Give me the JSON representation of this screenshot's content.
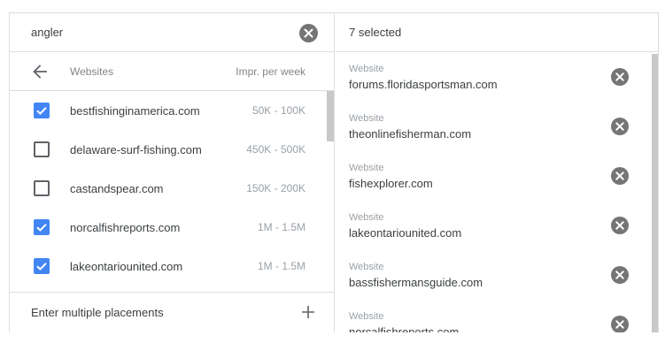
{
  "search": {
    "value": "angler",
    "clear_icon": "clear-circle-icon"
  },
  "table_header": {
    "back_icon": "arrow-back-icon",
    "col_websites": "Websites",
    "col_impressions": "Impr. per week"
  },
  "results": [
    {
      "name": "bestfishinginamerica.com",
      "impressions": "50K - 100K",
      "checked": true
    },
    {
      "name": "delaware-surf-fishing.com",
      "impressions": "450K - 500K",
      "checked": false
    },
    {
      "name": "castandspear.com",
      "impressions": "150K - 200K",
      "checked": false
    },
    {
      "name": "norcalfishreports.com",
      "impressions": "1M - 1.5M",
      "checked": true
    },
    {
      "name": "lakeontariounited.com",
      "impressions": "1M - 1.5M",
      "checked": true
    }
  ],
  "footer": {
    "label": "Enter multiple placements",
    "add_icon": "plus-icon"
  },
  "selected_panel": {
    "count_label": "7 selected",
    "items": [
      {
        "type": "Website",
        "name": "forums.floridasportsman.com"
      },
      {
        "type": "Website",
        "name": "theonlinefisherman.com"
      },
      {
        "type": "Website",
        "name": "fishexplorer.com"
      },
      {
        "type": "Website",
        "name": "lakeontariounited.com"
      },
      {
        "type": "Website",
        "name": "bassfishermansguide.com"
      },
      {
        "type": "Website",
        "name": "norcalfishreports.com"
      }
    ],
    "remove_icon": "remove-circle-icon"
  },
  "colors": {
    "checkbox_checked": "#4285f4",
    "icon_gray": "#757575",
    "divider": "#dadce0"
  }
}
